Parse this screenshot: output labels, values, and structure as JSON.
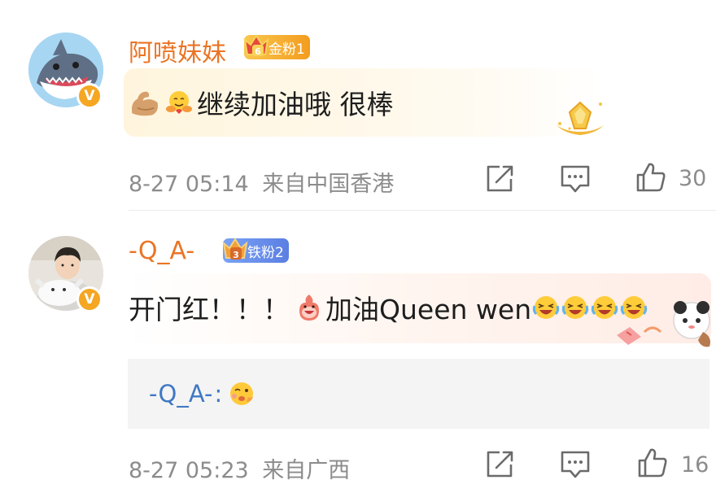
{
  "comments": [
    {
      "username": "阿喷妹妹",
      "fan_badge": {
        "level": "6",
        "label": "金粉1",
        "color": "#f7b733"
      },
      "text": "继续加油哦 很棒",
      "time": "8-27 05:14",
      "location": "来自中国香港",
      "likes": "30",
      "verified_mark": "V"
    },
    {
      "username": "-Q_A-",
      "fan_badge": {
        "level": "3",
        "label": "铁粉2",
        "color": "#6b8fe8"
      },
      "text_prefix": "开门红！！！",
      "text_main": "加油Queen wen",
      "time": "8-27 05:23",
      "location": "来自广西",
      "likes": "16",
      "verified_mark": "V",
      "reply": {
        "author": "-Q_A-",
        "separator": ":"
      }
    }
  ],
  "icons": {
    "share": "share-icon",
    "comment": "comment-icon",
    "like": "thumbs-up-icon",
    "muscle": "flexed-biceps-emoji",
    "hug": "hugging-emoji",
    "fire": "fire-mascot-emoji",
    "laugh": "laughing-emoji",
    "cute": "cute-face-emoji"
  },
  "colors": {
    "username": "#ea7424",
    "reply_author": "#3f78c4",
    "meta": "#8c8c8c"
  }
}
